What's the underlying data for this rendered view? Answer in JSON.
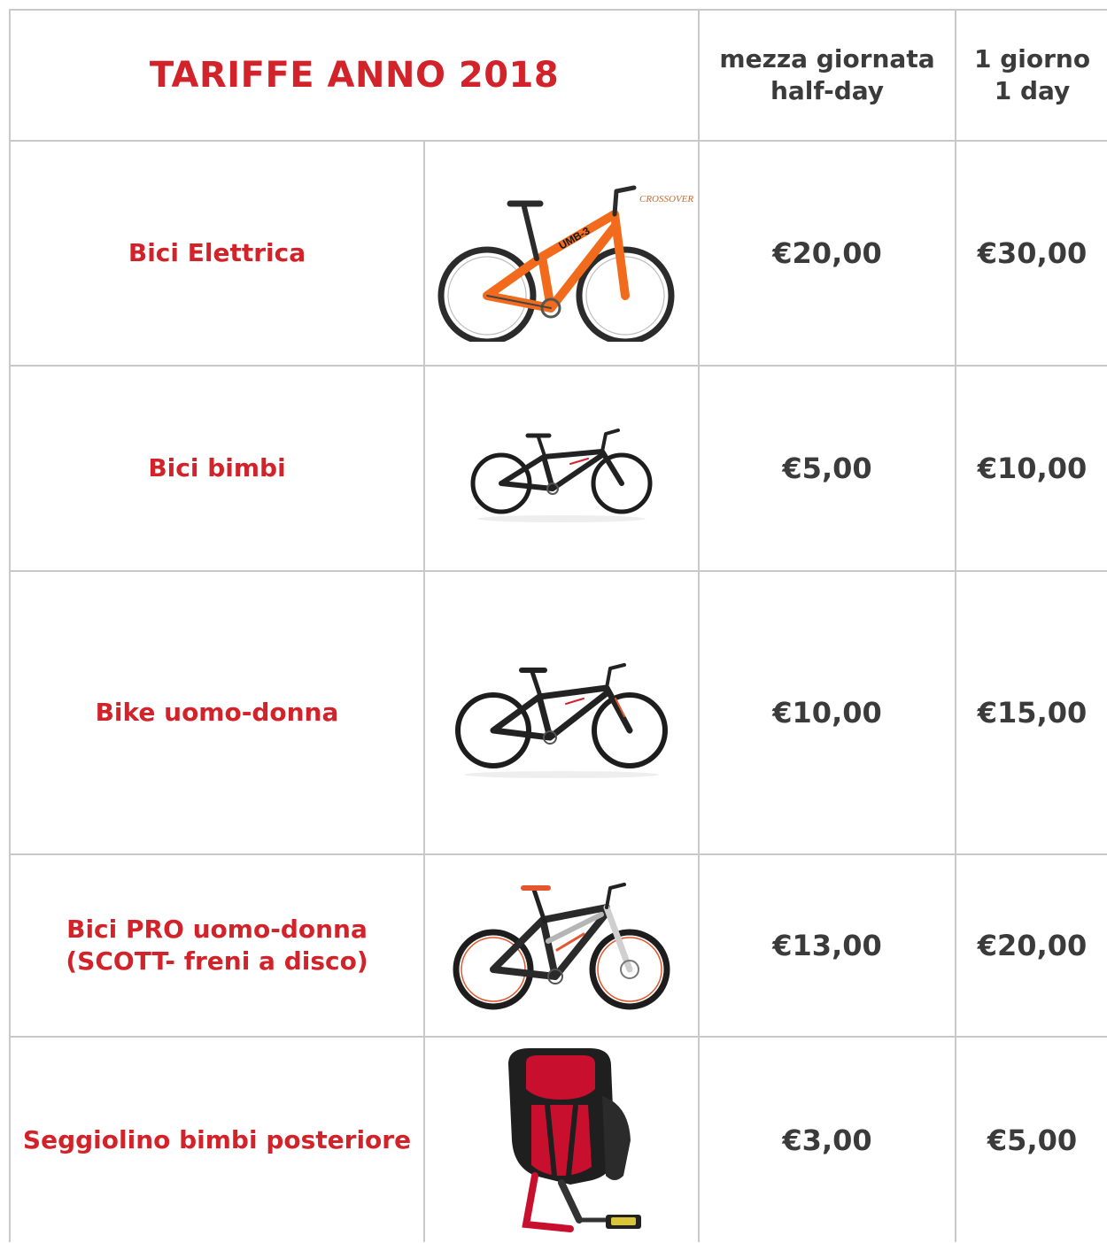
{
  "header": {
    "title": "TARIFFE ANNO 2018",
    "half_day": [
      "mezza giornata",
      "half-day"
    ],
    "full_day": [
      "1 giorno",
      "1 day"
    ]
  },
  "items": [
    {
      "name": [
        "Bici Elettrica"
      ],
      "image": "electric-bike-icon",
      "brand_text": "CROSSOVER",
      "frame_text": "UMB-3",
      "half_day": "€20,00",
      "full_day": "€30,00"
    },
    {
      "name": [
        "Bici bimbi"
      ],
      "image": "kids-bike-icon",
      "half_day": "€5,00",
      "full_day": "€10,00"
    },
    {
      "name": [
        "Bike uomo-donna"
      ],
      "image": "adult-bike-icon",
      "half_day": "€10,00",
      "full_day": "€15,00"
    },
    {
      "name": [
        "Bici PRO uomo-donna",
        "(SCOTT- freni a disco)"
      ],
      "image": "pro-bike-icon",
      "half_day": "€13,00",
      "full_day": "€20,00"
    },
    {
      "name": [
        "Seggiolino bimbi posteriore"
      ],
      "image": "child-seat-icon",
      "half_day": "€3,00",
      "full_day": "€5,00"
    }
  ],
  "colors": {
    "accent_red": "#d2232a",
    "text_dark": "#3b3b3b",
    "grid": "#c9c9c9",
    "bike_orange": "#f26b1d"
  }
}
